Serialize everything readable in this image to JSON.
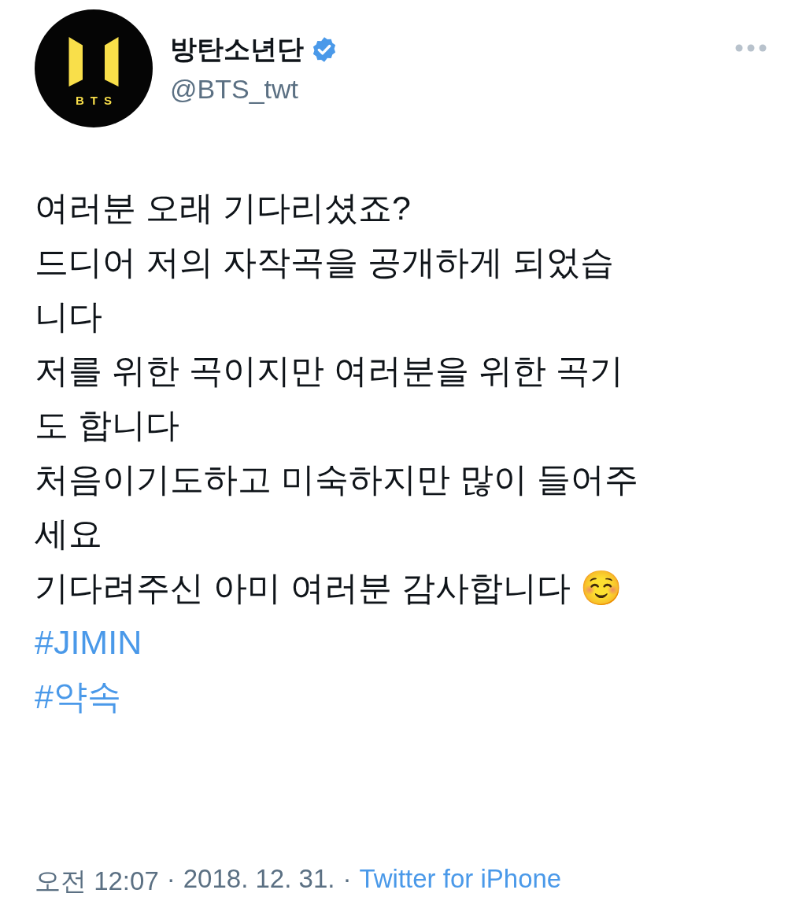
{
  "tweet": {
    "author": {
      "name": "방탄소년단",
      "verified": true,
      "handle": "@BTS_twt",
      "avatar_text": "BTS"
    },
    "lines": [
      {
        "kind": "text",
        "text": "여러분 오래 기다리셨죠?"
      },
      {
        "kind": "text",
        "text": "드디어 저의 자작곡을 공개하게 되었습"
      },
      {
        "kind": "text",
        "text": "니다"
      },
      {
        "kind": "text",
        "text": "저를 위한 곡이지만 여러분을 위한 곡기"
      },
      {
        "kind": "text",
        "text": "도 합니다"
      },
      {
        "kind": "text",
        "text": "처음이기도하고 미숙하지만 많이 들어주"
      },
      {
        "kind": "text",
        "text": "세요"
      },
      {
        "kind": "text",
        "text": "기다려주신 아미 여러분 감사합니다 ☺️"
      },
      {
        "kind": "hashtag",
        "text": "#JIMIN"
      },
      {
        "kind": "hashtag",
        "text": "#약속"
      }
    ],
    "separator": "·",
    "time": "오전 12:07",
    "date": "2018. 12. 31.",
    "source": "Twitter for iPhone"
  }
}
